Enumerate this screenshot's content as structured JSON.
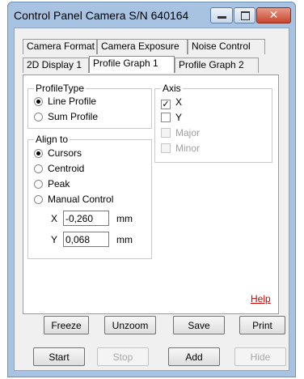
{
  "window": {
    "title": "Control Panel Camera S/N 640164",
    "close_glyph": "✕"
  },
  "tabs": {
    "row1": [
      "Camera Format",
      "Camera Exposure",
      "Noise Control"
    ],
    "row2": [
      "2D Display 1",
      "Profile Graph 1",
      "Profile Graph 2"
    ],
    "active": "Profile Graph 1"
  },
  "profile_type": {
    "legend": "ProfileType",
    "options": [
      {
        "label": "Line Profile",
        "selected": true
      },
      {
        "label": "Sum Profile",
        "selected": false
      }
    ]
  },
  "axis": {
    "legend": "Axis",
    "options": [
      {
        "label": "X",
        "checked": true,
        "enabled": true
      },
      {
        "label": "Y",
        "checked": false,
        "enabled": true
      },
      {
        "label": "Major",
        "checked": false,
        "enabled": false
      },
      {
        "label": "Minor",
        "checked": false,
        "enabled": false
      }
    ],
    "check_glyph": "✓"
  },
  "align_to": {
    "legend": "Align to",
    "options": [
      {
        "label": "Cursors",
        "selected": true
      },
      {
        "label": "Centroid",
        "selected": false
      },
      {
        "label": "Peak",
        "selected": false
      },
      {
        "label": "Manual Control",
        "selected": false
      }
    ],
    "x_label": "X",
    "x_value": "-0,260",
    "x_unit": "mm",
    "y_label": "Y",
    "y_value": "0,068",
    "y_unit": "mm"
  },
  "help": "Help",
  "buttons_row1": [
    "Freeze",
    "Unzoom",
    "Save",
    "Print"
  ],
  "buttons_row2": [
    {
      "label": "Start",
      "enabled": true
    },
    {
      "label": "Stop",
      "enabled": false
    },
    {
      "label": "Add",
      "enabled": true
    },
    {
      "label": "Hide",
      "enabled": false
    }
  ]
}
